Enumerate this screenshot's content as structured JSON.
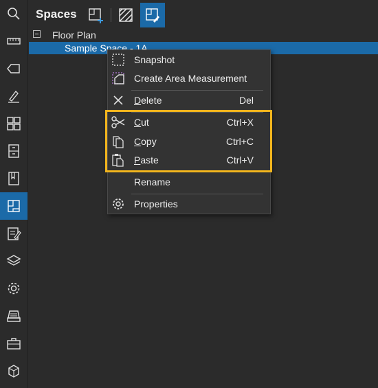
{
  "panel": {
    "title": "Spaces"
  },
  "toolbar": {
    "buttons": [
      {
        "icon": "add-space-icon"
      },
      {
        "icon": "hatch-icon"
      },
      {
        "icon": "edit-space-icon",
        "active": true
      }
    ]
  },
  "sidebar": {
    "items": [
      {
        "icon": "search-icon"
      },
      {
        "icon": "ruler-icon"
      },
      {
        "icon": "tag-icon"
      },
      {
        "icon": "markup-pen-icon"
      },
      {
        "icon": "thumbnails-grid-icon"
      },
      {
        "icon": "file-cabinet-icon"
      },
      {
        "icon": "bookmark-icon"
      },
      {
        "icon": "spaces-icon",
        "active": true
      },
      {
        "icon": "markups-list-icon"
      },
      {
        "icon": "layers-icon"
      },
      {
        "icon": "settings-gear-icon"
      },
      {
        "icon": "scanner-icon"
      },
      {
        "icon": "toolbox-icon"
      },
      {
        "icon": "3d-shape-icon"
      }
    ]
  },
  "tree": {
    "floor": "Floor Plan",
    "space": "Sample Space - 1A"
  },
  "context_menu": {
    "items": [
      {
        "label": "Snapshot",
        "icon": "snapshot-icon",
        "shortcut": ""
      },
      {
        "label": "Create Area Measurement",
        "icon": "area-measure-icon",
        "shortcut": ""
      },
      {
        "label": "Delete",
        "icon": "delete-x-icon",
        "shortcut": "Del"
      },
      {
        "label": "Cut",
        "icon": "scissors-icon",
        "shortcut": "Ctrl+X"
      },
      {
        "label": "Copy",
        "icon": "copy-icon",
        "shortcut": "Ctrl+C"
      },
      {
        "label": "Paste",
        "icon": "paste-icon",
        "shortcut": "Ctrl+V"
      },
      {
        "label": "Rename",
        "icon": "",
        "shortcut": ""
      },
      {
        "label": "Properties",
        "icon": "gear-icon",
        "shortcut": ""
      }
    ]
  },
  "colors": {
    "background": "#2b2b2b",
    "accent": "#1b6aa8",
    "highlight": "#f2b51d",
    "menu_bg": "#333333"
  }
}
